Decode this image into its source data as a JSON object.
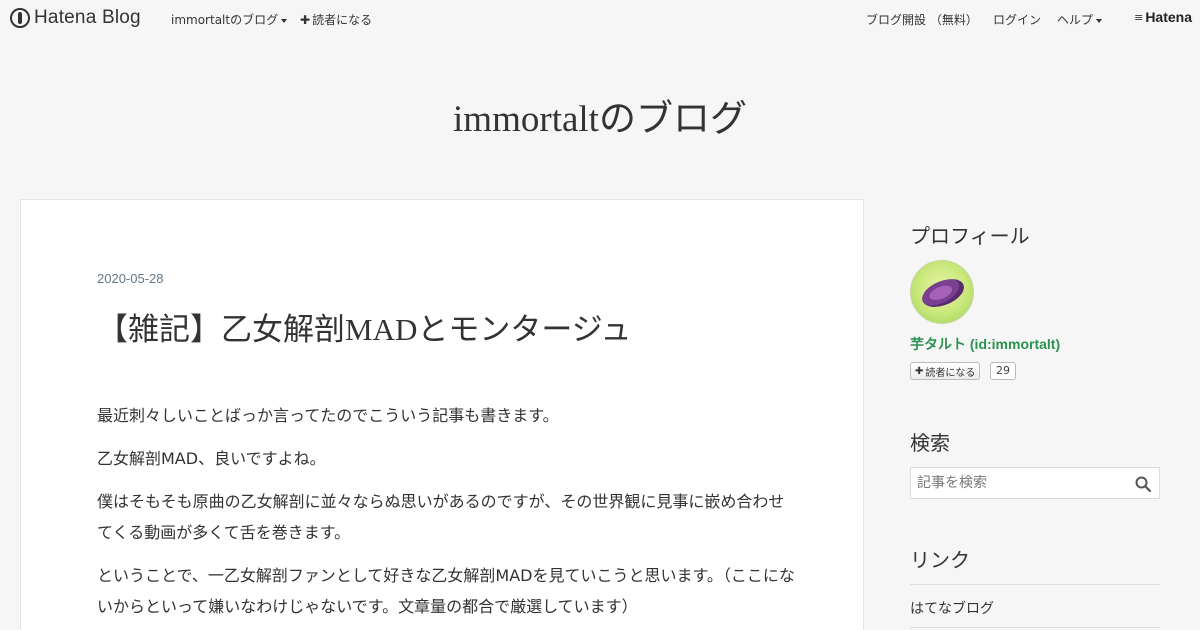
{
  "header": {
    "logo_text": "Hatena Blog",
    "blog_menu": "immortaltのブログ",
    "subscribe": "読者になる",
    "open_blog": "ブログ開設 （無料）",
    "login": "ログイン",
    "help": "ヘルプ",
    "hatena": "Hatena"
  },
  "blog": {
    "title": "immortaltのブログ"
  },
  "entry": {
    "date": "2020-05-28",
    "title": "【雑記】乙女解剖MADとモンタージュ",
    "paragraphs": [
      "最近刺々しいことばっか言ってたのでこういう記事も書きます。",
      "乙女解剖MAD、良いですよね。",
      "僕はそもそも原曲の乙女解剖に並々ならぬ思いがあるのですが、その世界観に見事に嵌め合わせてくる動画が多くて舌を巻きます。",
      "ということで、一乙女解剖ファンとして好きな乙女解剖MADを見ていこうと思います。（ここにないからといって嫌いなわけじゃないです。文章量の都合で厳選しています）"
    ]
  },
  "sidebar": {
    "profile_title": "プロフィール",
    "profile_name": "芋タルト (id:immortalt)",
    "reader_button": "読者になる",
    "reader_count": "29",
    "search_title": "検索",
    "search_placeholder": "記事を検索",
    "links_title": "リンク",
    "links": [
      "はてなブログ"
    ]
  },
  "icons": {
    "logo": "hatena-blog-logo-icon",
    "search": "search-icon",
    "avatar": "sweet-potato-avatar"
  },
  "colors": {
    "background": "#f6f6f7",
    "profile_name": "#2b9150",
    "date": "#657786"
  }
}
